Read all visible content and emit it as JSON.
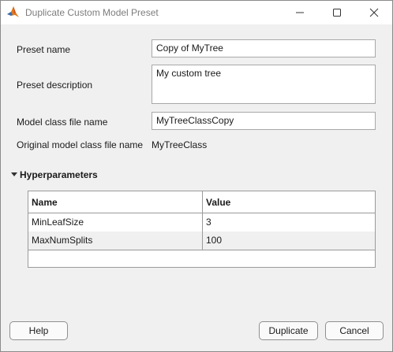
{
  "window": {
    "title": "Duplicate Custom Model Preset",
    "app_icon": "matlab-icon",
    "controls": [
      "minimize-icon",
      "maximize-icon",
      "close-icon"
    ]
  },
  "form": {
    "preset_name_label": "Preset name",
    "preset_name_value": "Copy of MyTree",
    "preset_description_label": "Preset description",
    "preset_description_value": "My custom tree",
    "model_class_label": "Model class file name",
    "model_class_value": "MyTreeClassCopy",
    "original_class_label": "Original model class file name",
    "original_class_value": "MyTreeClass"
  },
  "hyperparameters": {
    "section_title": "Hyperparameters",
    "expanded": true,
    "columns": [
      "Name",
      "Value"
    ],
    "rows": [
      {
        "name": "MinLeafSize",
        "value": "3"
      },
      {
        "name": "MaxNumSplits",
        "value": "100"
      }
    ]
  },
  "buttons": {
    "help": "Help",
    "duplicate": "Duplicate",
    "cancel": "Cancel"
  }
}
